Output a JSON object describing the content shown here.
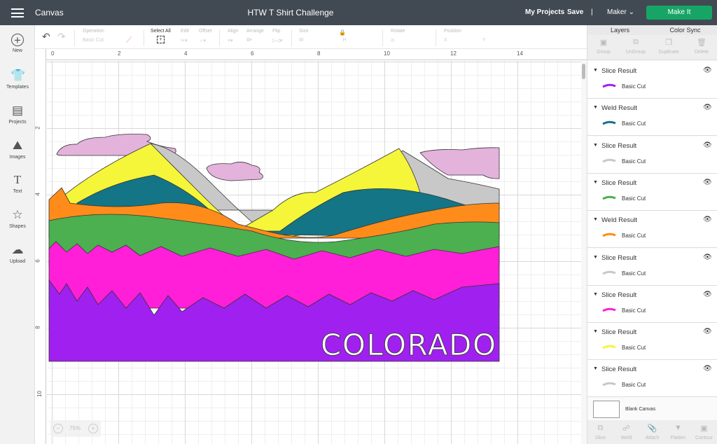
{
  "topbar": {
    "section": "Canvas",
    "title": "HTW T Shirt Challenge",
    "my_projects": "My Projects",
    "save": "Save",
    "divider": "|",
    "machine": "Maker",
    "make_it": "Make It"
  },
  "sidebar": {
    "items": [
      {
        "label": "New",
        "icon": "plus-circle-icon"
      },
      {
        "label": "Templates",
        "icon": "tshirt-icon"
      },
      {
        "label": "Projects",
        "icon": "notebook-icon"
      },
      {
        "label": "Images",
        "icon": "image-icon"
      },
      {
        "label": "Text",
        "icon": "text-icon"
      },
      {
        "label": "Shapes",
        "icon": "shapes-icon"
      },
      {
        "label": "Upload",
        "icon": "cloud-upload-icon"
      }
    ]
  },
  "toolbar": {
    "operation_label": "Operation",
    "operation_value": "Basic Cut",
    "select_all": "Select All",
    "edit": "Edit",
    "offset": "Offset",
    "align": "Align",
    "arrange": "Arrange",
    "flip": "Flip",
    "size": "Size",
    "w": "W",
    "h": "H",
    "rotate": "Rotate",
    "position": "Position",
    "x": "X",
    "y": "Y"
  },
  "ruler": {
    "h": [
      "0",
      "2",
      "4",
      "6",
      "8",
      "10",
      "12",
      "14"
    ],
    "v": [
      "2",
      "4",
      "6",
      "8",
      "10"
    ]
  },
  "canvas": {
    "artwork_text": "COLORADO",
    "zoom": "75%",
    "colors": {
      "purple": "#a020f0",
      "pink": "#ff1fd8",
      "green": "#4caf50",
      "orange": "#ff8c1a",
      "teal": "#137585",
      "yellow": "#f5f53a",
      "gray": "#c8c8c8",
      "cloud": "#e3b3dc"
    }
  },
  "panel": {
    "tabs": [
      "Layers",
      "Color Sync"
    ],
    "tools": [
      "Group",
      "UnGroup",
      "Duplicate",
      "Delete"
    ],
    "layers": [
      {
        "title": "Slice Result",
        "sub": "Basic Cut",
        "color": "#a020f0"
      },
      {
        "title": "Weld Result",
        "sub": "Basic Cut",
        "color": "#137585"
      },
      {
        "title": "Slice Result",
        "sub": "Basic Cut",
        "color": "#c8c8c8"
      },
      {
        "title": "Slice Result",
        "sub": "Basic Cut",
        "color": "#4caf50"
      },
      {
        "title": "Weld Result",
        "sub": "Basic Cut",
        "color": "#ff8c1a"
      },
      {
        "title": "Slice Result",
        "sub": "Basic Cut",
        "color": "#c8c8c8"
      },
      {
        "title": "Slice Result",
        "sub": "Basic Cut",
        "color": "#ff1fd8"
      },
      {
        "title": "Slice Result",
        "sub": "Basic Cut",
        "color": "#f5f53a"
      },
      {
        "title": "Slice Result",
        "sub": "Basic Cut",
        "color": "#c8c8c8"
      }
    ],
    "blank_canvas": "Blank Canvas",
    "bottom_tools": [
      "Slice",
      "Weld",
      "Attach",
      "Flatten",
      "Contour"
    ]
  },
  "accent": "#17a566"
}
